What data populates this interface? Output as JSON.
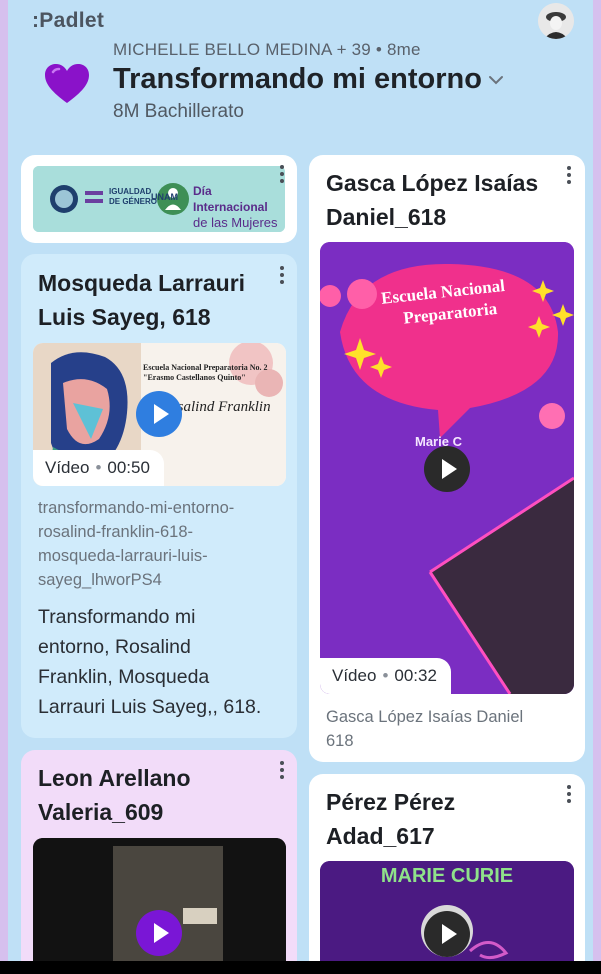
{
  "app": {
    "logo": ":Padlet"
  },
  "header": {
    "byline": "MICHELLE BELLO MEDINA + 39 • 8me",
    "title": "Transformando mi entorno",
    "subtitle": "8M Bachillerato"
  },
  "banner": {
    "igualdad_line1": "IGUALDAD",
    "igualdad_line2": "DE GÉNERO",
    "unam": "UNAM",
    "dia_line1": "Día Internacional",
    "dia_line2": "de las Mujeres"
  },
  "posts": [
    {
      "title_line1": "Mosqueda Larrauri",
      "title_line2": "Luis Sayeg, 618",
      "thumb_heading": "Escuela Nacional Preparatoria No. 2",
      "thumb_sub": "\"Erasmo Castellanos Quinto\"",
      "thumb_name": "Rosalind Franklin",
      "tag_type": "Vídeo",
      "tag_duration": "00:50",
      "url_line1": "transformando-mi-entorno-",
      "url_line2": "rosalind-franklin-618-",
      "url_line3": "mosqueda-larrauri-luis-",
      "url_line4": "sayeg_lhworPS4",
      "desc_line1": "Transformando mi",
      "desc_line2": "entorno, Rosalind",
      "desc_line3": "Franklin, Mosqueda",
      "desc_line4": "Larrauri Luis Sayeg,, 618."
    },
    {
      "title_line1": "Gasca López Isaías",
      "title_line2": "Daniel_618",
      "thumb_text1": "Escuela Nacional",
      "thumb_text2": "Preparatoria",
      "thumb_name": "Marie C",
      "tag_type": "Vídeo",
      "tag_duration": "00:32",
      "cap_line1": "Gasca López Isaías Daniel",
      "cap_line2": "618"
    },
    {
      "title_line1": "Leon Arellano",
      "title_line2": "Valeria_609"
    },
    {
      "title_line1": "Pérez Pérez",
      "title_line2": "Adad_617",
      "thumb_text": "MARIE CURIE"
    }
  ],
  "colors": {
    "background": "#bfe0f6",
    "heart": "#8a12c9",
    "play_blue": "#2f7ee0",
    "play_purple": "#7a16d6",
    "video_purple": "#7b2dc2"
  }
}
